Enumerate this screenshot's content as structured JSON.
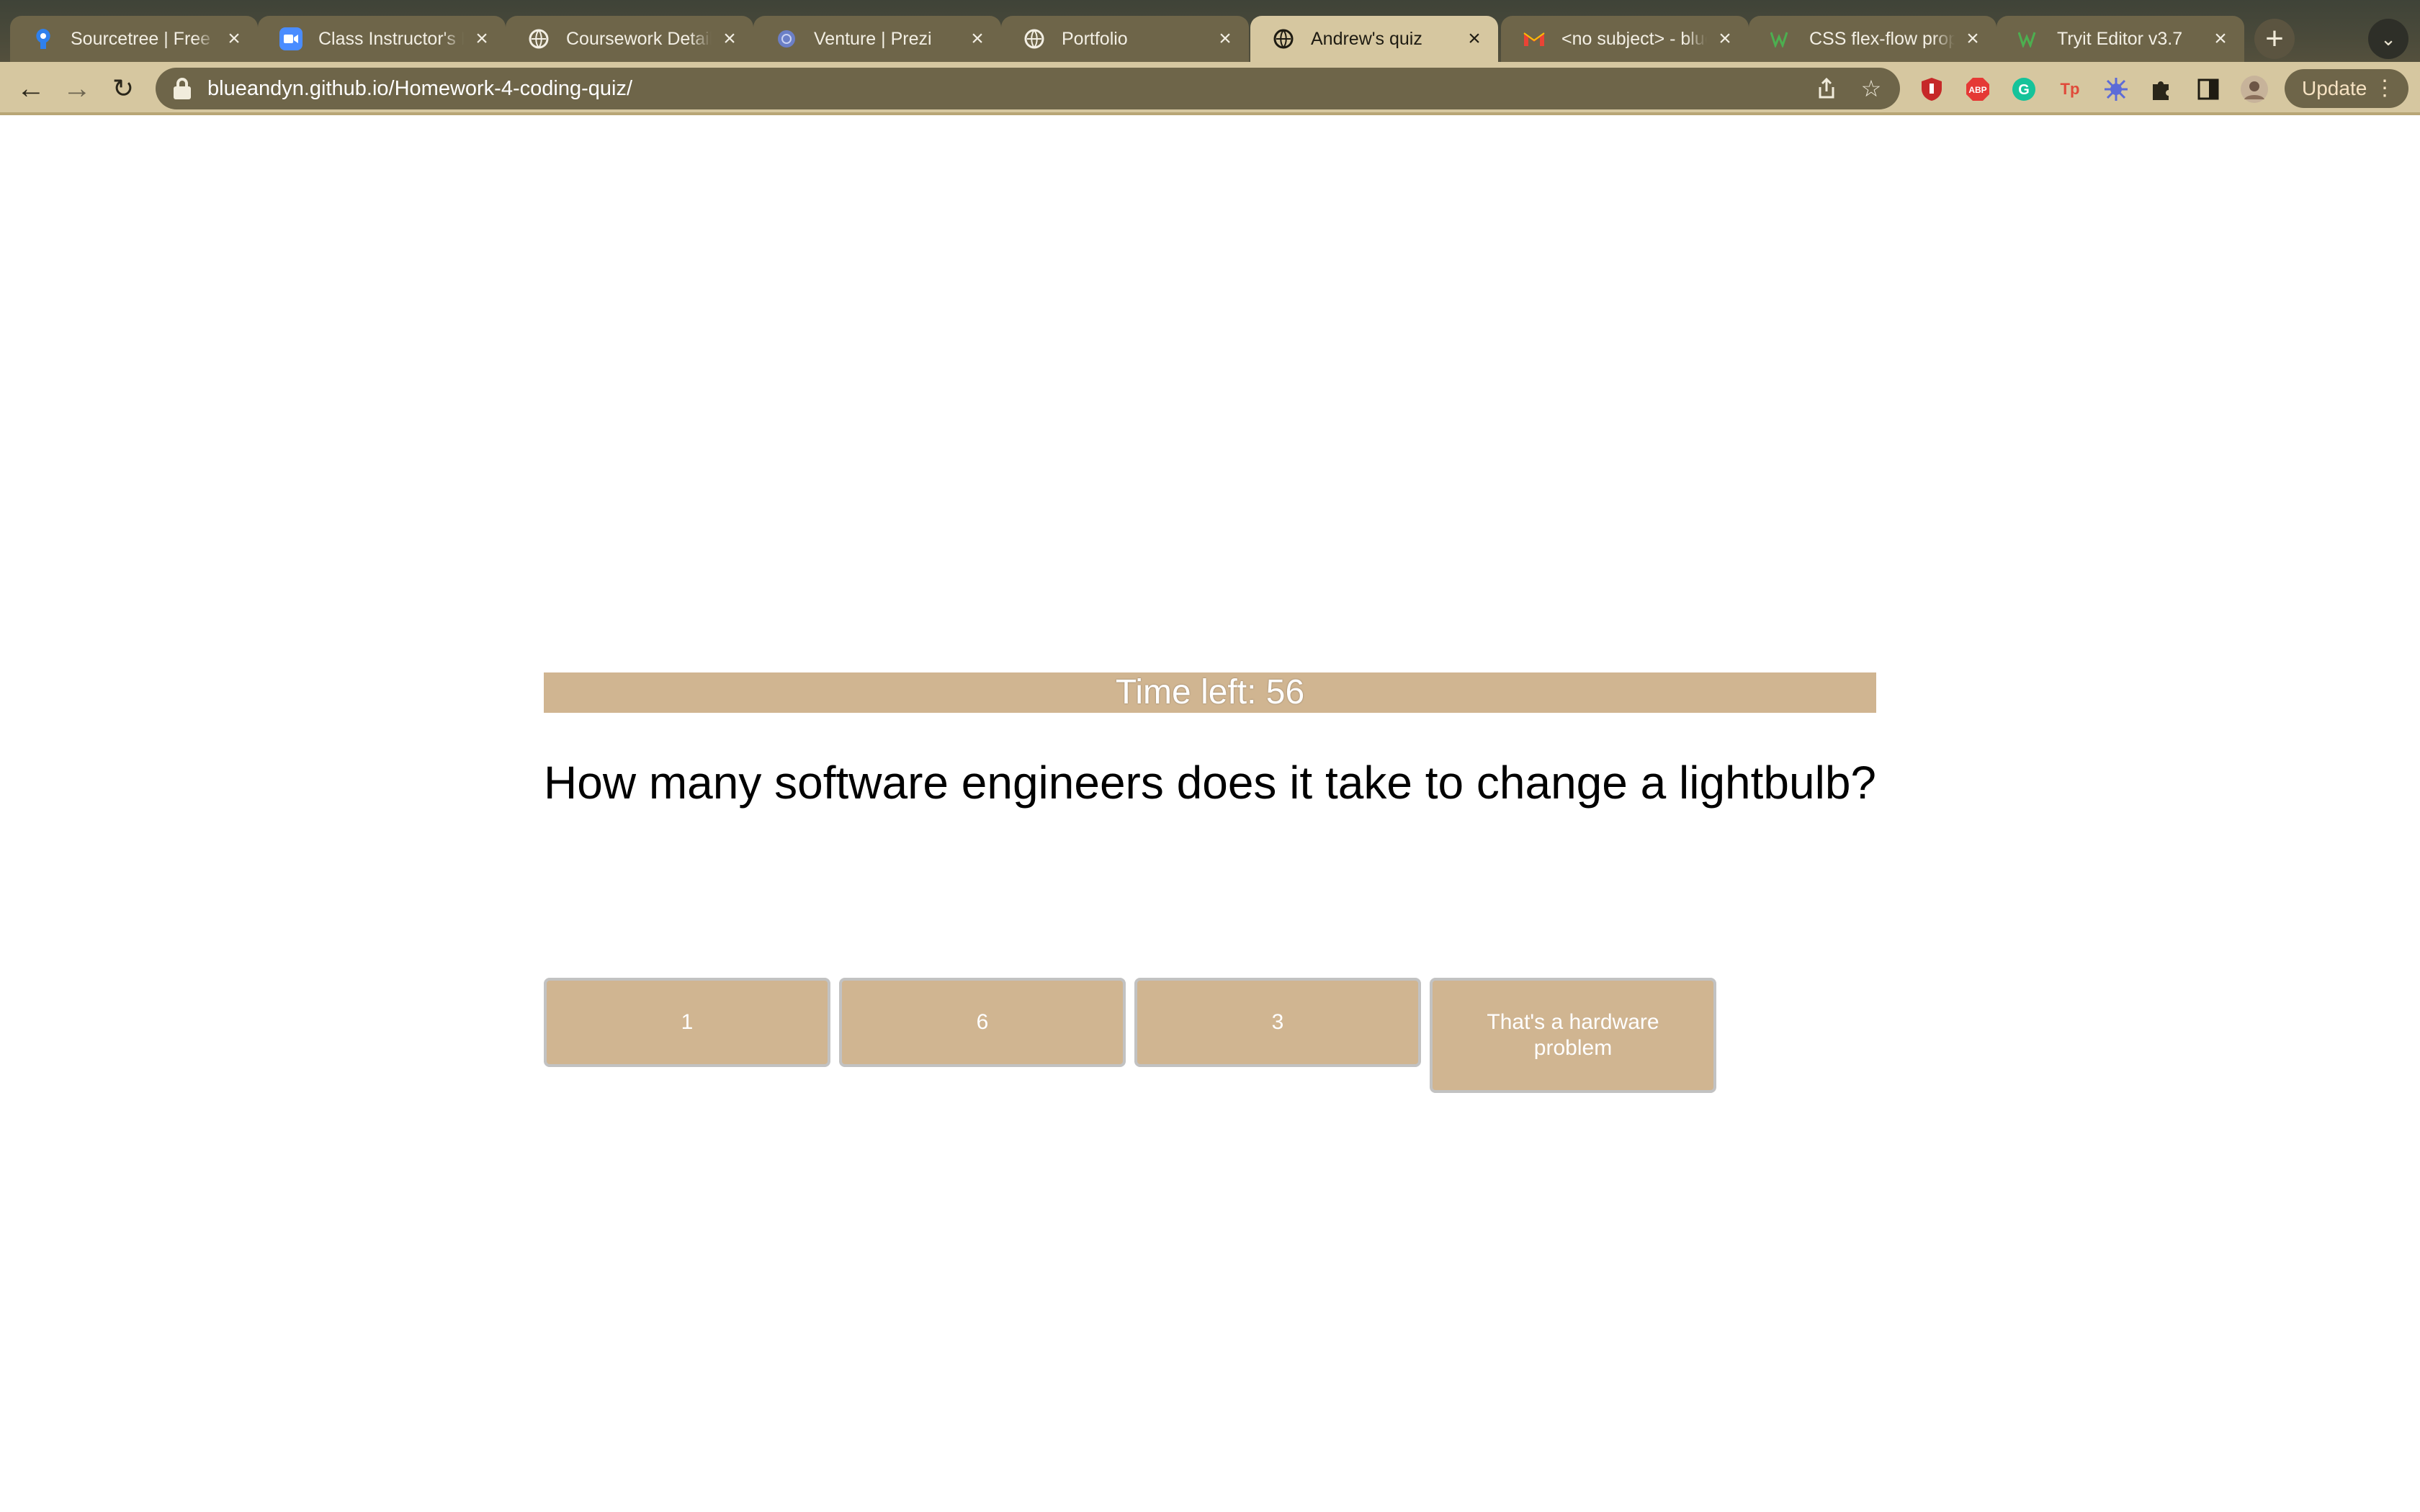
{
  "browser": {
    "tabs": [
      {
        "title": "Sourcetree | Free G",
        "icon": "sourcetree-icon",
        "active": false
      },
      {
        "title": "Class Instructor's R",
        "icon": "zoom-icon",
        "active": false
      },
      {
        "title": "Coursework Detail",
        "icon": "globe-icon",
        "active": false
      },
      {
        "title": "Venture | Prezi",
        "icon": "prezi-icon",
        "active": false
      },
      {
        "title": "Portfolio",
        "icon": "globe-icon",
        "active": false
      },
      {
        "title": "Andrew's quiz",
        "icon": "globe-icon",
        "active": true
      },
      {
        "title": "<no subject> - blue",
        "icon": "gmail-icon",
        "active": false
      },
      {
        "title": "CSS flex-flow prop",
        "icon": "w3schools-icon",
        "active": false
      },
      {
        "title": "Tryit Editor v3.7",
        "icon": "w3schools-icon",
        "active": false
      }
    ],
    "url": "blueandyn.github.io/Homework-4-coding-quiz/",
    "update_label": "Update",
    "extensions": [
      "ublock-icon",
      "adblock-plus-icon",
      "grammarly-icon",
      "tp-icon",
      "extension-star-icon",
      "puzzle-icon",
      "side-panel-icon",
      "profile-avatar-icon"
    ],
    "colors": {
      "tab_active": "#d6c7a0",
      "tab_inactive": "#6e6549",
      "toolbar": "#d6c7a0"
    }
  },
  "quiz": {
    "timer_text": "Time left: 56",
    "question": "How many software engineers does it take to change a lightbulb?",
    "answers": [
      "1",
      "6",
      "3",
      "That's a hardware problem"
    ],
    "colors": {
      "accent": "#d0b591",
      "button_border": "#c2c2c2"
    }
  }
}
